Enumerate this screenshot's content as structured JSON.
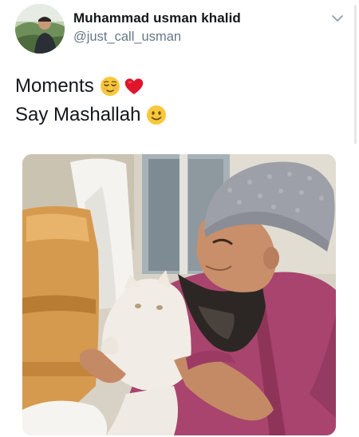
{
  "tweet": {
    "author": {
      "display_name": "Muhammad usman khalid",
      "handle": "@just_call_usman"
    },
    "text_lines": [
      {
        "text": "Moments",
        "emojis": [
          "relieved-face-emoji",
          "red-heart-emoji"
        ]
      },
      {
        "text": "Say Mashallah",
        "emojis": [
          "slightly-smiling-face-emoji"
        ]
      }
    ],
    "icons": {
      "menu": "chevron-down-icon"
    },
    "media": {
      "type": "photo"
    },
    "colors": {
      "name": "#14171a",
      "handle": "#657786",
      "chevron": "#8899a6",
      "emoji_yellow": "#f7c83a",
      "heart": "#e0142a"
    }
  }
}
